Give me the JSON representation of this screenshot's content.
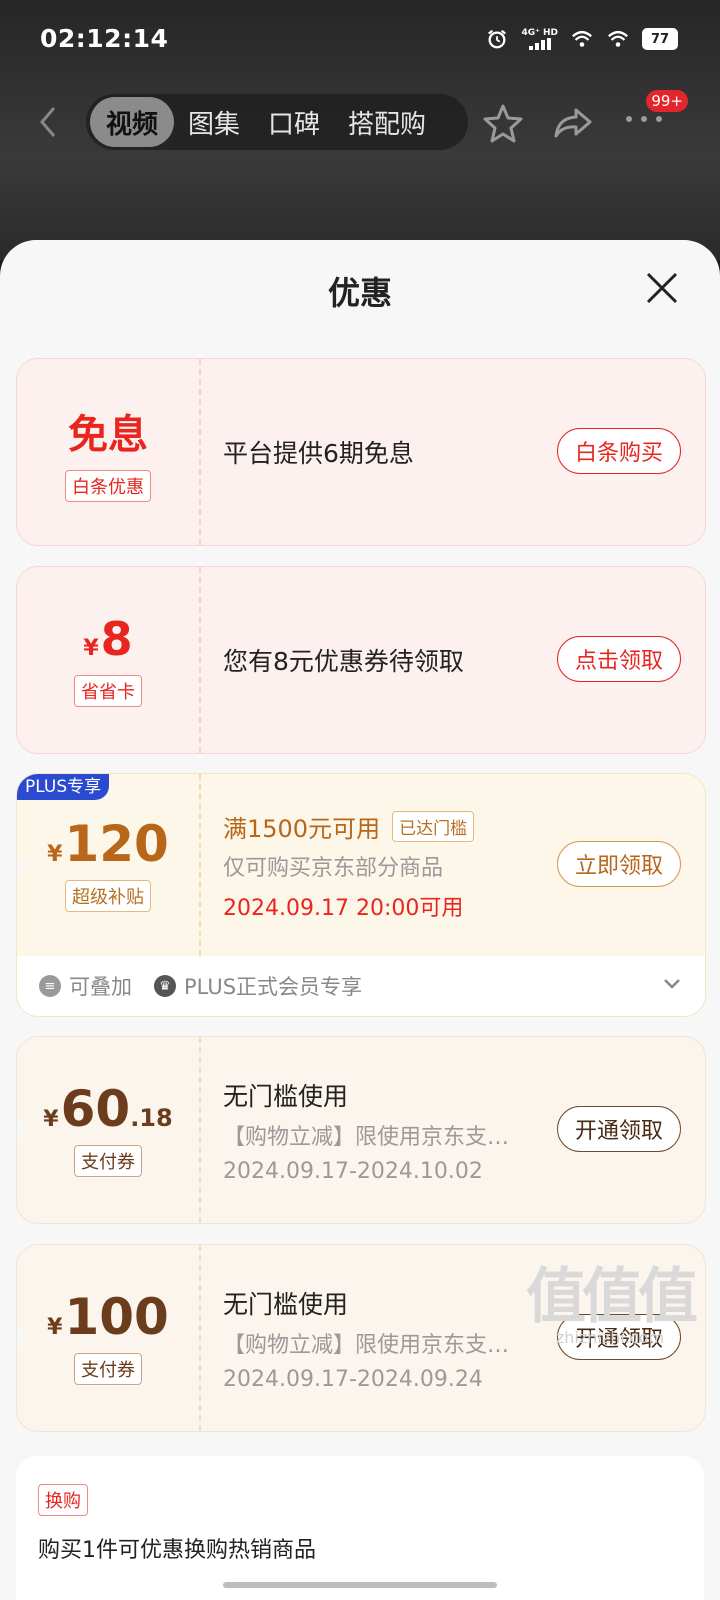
{
  "status_bar": {
    "time": "02:12:14",
    "network": "4G⁺ HD",
    "battery": "77"
  },
  "nav": {
    "tabs": [
      {
        "label": "视频",
        "active": true
      },
      {
        "label": "图集",
        "active": false
      },
      {
        "label": "口碑",
        "active": false
      },
      {
        "label": "搭配购",
        "active": false
      }
    ],
    "badge": "99+"
  },
  "sheet": {
    "title": "优惠"
  },
  "coupons": [
    {
      "type": "red",
      "big_text": "免息",
      "tag": "白条优惠",
      "text": "平台提供6期免息",
      "button": "白条购买"
    },
    {
      "type": "red",
      "currency": "¥",
      "amount": "8",
      "tag": "省省卡",
      "text": "您有8元优惠券待领取",
      "button": "点击领取"
    },
    {
      "type": "gold",
      "badge": "PLUS专享",
      "currency": "¥",
      "amount": "120",
      "tag": "超级补贴",
      "line1": "满1500元可用",
      "status": "已达门槛",
      "line2": "仅可购买京东部分商品",
      "line3": "2024.09.17 20:00可用",
      "button": "立即领取",
      "foot_stack": "可叠加",
      "foot_plus": "PLUS正式会员专享"
    },
    {
      "type": "beige",
      "currency": "¥",
      "amount": "60",
      "decimal": ".18",
      "tag": "支付券",
      "line1": "无门槛使用",
      "line2": "【购物立减】限使用京东支…",
      "line3": "2024.09.17-2024.10.02",
      "button": "开通领取"
    },
    {
      "type": "beige",
      "currency": "¥",
      "amount": "100",
      "tag": "支付券",
      "line1": "无门槛使用",
      "line2": "【购物立减】限使用京东支…",
      "line3": "2024.09.17-2024.09.24",
      "button": "开通领取"
    }
  ],
  "exchange": {
    "tag": "换购",
    "text": "购买1件可优惠换购热销商品"
  },
  "watermark": {
    "big": "值值值",
    "small": "zhizhizhi.com"
  },
  "colors": {
    "red": "#e8261f",
    "gold": "#b8661a",
    "plus_blue": "#2a4ad0",
    "brown": "#6b3d1c"
  }
}
